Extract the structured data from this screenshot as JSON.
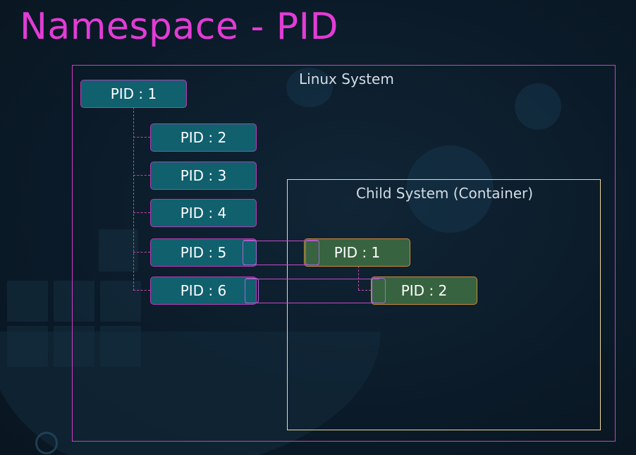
{
  "title": "Namespace - PID",
  "outer_label": "Linux System",
  "inner_label": "Child System (Container)",
  "host_pids": [
    {
      "label": "PID : 1"
    },
    {
      "label": "PID : 2"
    },
    {
      "label": "PID : 3"
    },
    {
      "label": "PID : 4"
    },
    {
      "label": "PID : 5"
    },
    {
      "label": "PID : 6"
    }
  ],
  "container_pids": [
    {
      "label": "PID : 1"
    },
    {
      "label": "PID : 2"
    }
  ],
  "colors": {
    "title": "#e23cd6",
    "outer_border": "#d43bc9",
    "inner_border": "#f0d9a0",
    "host_fill": "#10606e",
    "container_fill": "#386340",
    "container_border": "#cc8a3a"
  }
}
